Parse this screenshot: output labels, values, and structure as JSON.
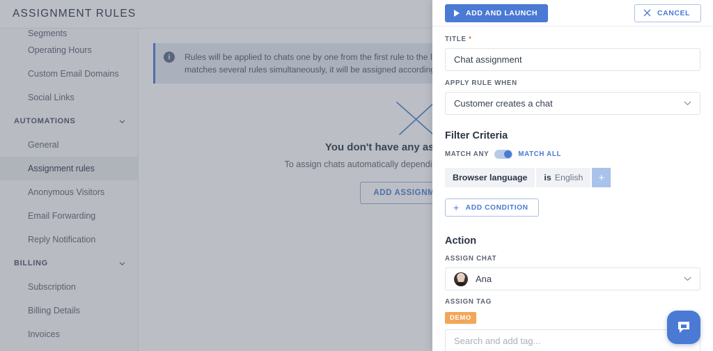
{
  "app": {
    "title": "ASSIGNMENT RULES"
  },
  "sidebar": {
    "items": [
      {
        "label": "Segments",
        "type": "item",
        "state": "clipped"
      },
      {
        "label": "Operating Hours",
        "type": "item",
        "state": "normal"
      },
      {
        "label": "Custom Email Domains",
        "type": "item",
        "state": "normal"
      },
      {
        "label": "Social Links",
        "type": "item",
        "state": "normal"
      },
      {
        "label": "AUTOMATIONS",
        "type": "group",
        "state": "expanded"
      },
      {
        "label": "General",
        "type": "item",
        "state": "normal"
      },
      {
        "label": "Assignment rules",
        "type": "item",
        "state": "active"
      },
      {
        "label": "Anonymous Visitors",
        "type": "item",
        "state": "normal"
      },
      {
        "label": "Email Forwarding",
        "type": "item",
        "state": "normal"
      },
      {
        "label": "Reply Notification",
        "type": "item",
        "state": "normal"
      },
      {
        "label": "BILLING",
        "type": "group",
        "state": "expanded"
      },
      {
        "label": "Subscription",
        "type": "item",
        "state": "normal"
      },
      {
        "label": "Billing Details",
        "type": "item",
        "state": "normal"
      },
      {
        "label": "Invoices",
        "type": "item",
        "state": "normal"
      }
    ]
  },
  "main": {
    "banner_text": "Rules will be applied to chats one by one from the first rule to the last one. To change the order, drag and drop the rules. If a chat matches several rules simultaneously, it will be assigned according to the first matching rule from your list.",
    "empty_title": "You don't have any assignment rules yet",
    "empty_subtitle": "To assign chats automatically depending on chosen criteria, create a rule",
    "empty_button": "ADD ASSIGNMENT RULE"
  },
  "panel": {
    "submit_label": "ADD AND LAUNCH",
    "cancel_label": "CANCEL",
    "title_label": "TITLE",
    "title_required_mark": "*",
    "title_value": "Chat assignment",
    "apply_rule_label": "APPLY RULE WHEN",
    "apply_rule_value": "Customer creates a chat",
    "filter_section": "Filter Criteria",
    "match_any_label": "MATCH ANY",
    "match_all_label": "MATCH ALL",
    "match_state": "MATCH ALL",
    "condition": {
      "attribute": "Browser language",
      "operator": "is",
      "value": "English",
      "add_value_label": "+"
    },
    "add_condition_label": "ADD CONDITION",
    "add_condition_icon": "+",
    "action_section": "Action",
    "assign_chat_label": "ASSIGN CHAT",
    "assign_chat_value": "Ana",
    "assign_tag_label": "ASSIGN TAG",
    "assigned_tag": "DEMO",
    "tag_search_placeholder": "Search and add tag...",
    "caret": "⌄"
  },
  "colors": {
    "accent": "#4a7ad4",
    "tag_orange": "#f2a659",
    "required": "#e8743b",
    "chip_bg": "#f1f2f5"
  }
}
